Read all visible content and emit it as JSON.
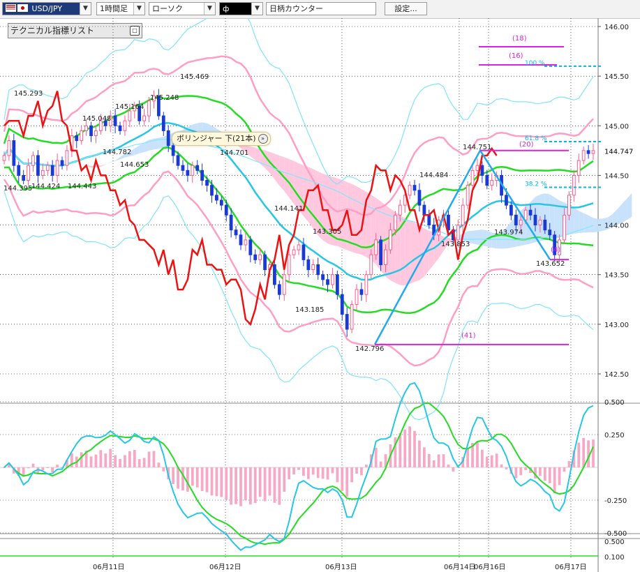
{
  "toolbar": {
    "pair": "USD/JPY",
    "timeframe": "1時間足",
    "chart_style": "ローソク",
    "symbol_box": "ф",
    "counter_label": "日柄カウンター",
    "settings_label": "設定..."
  },
  "indicator_panel": {
    "title": "テクニカル指標リスト"
  },
  "tooltip": {
    "text": "ボリンジャー 下(21本)"
  },
  "colors": {
    "up_candle": "#ff5a8a",
    "down_candle": "#1a3ad6",
    "bollinger_mid": "#26c6e6",
    "bollinger_inner": "#ff9ec4",
    "bollinger_outer": "#7fe3ff",
    "ma_green": "#22dd22",
    "red_line": "#ee1111",
    "cloud_pink": "#ffc8de",
    "cloud_blue": "#c8e2fb",
    "fib_cyan": "#00b4f0",
    "magenta": "#e020e0",
    "wave_line": "#20aaf0"
  },
  "chart_data": [
    {
      "type": "candlestick",
      "y_ticks": [
        "146.00",
        "145.50",
        "145.00",
        "144.50",
        "144.00",
        "143.50",
        "143.00",
        "142.50"
      ],
      "ylim": [
        142.4,
        146.05
      ],
      "x_ticks": [
        "06月11日",
        "06月12日",
        "06月13日",
        "06月14日",
        "06月16日",
        "06月17日"
      ],
      "last_price": "144.747",
      "price_labels": [
        {
          "text": "145.293",
          "value": 145.293
        },
        {
          "text": "144.395",
          "value": 144.395
        },
        {
          "text": "144.424",
          "value": 144.424
        },
        {
          "text": "144.443",
          "value": 144.443
        },
        {
          "text": "145.048",
          "value": 145.048
        },
        {
          "text": "144.782",
          "value": 144.782
        },
        {
          "text": "145.164",
          "value": 145.164
        },
        {
          "text": "144.653",
          "value": 144.653
        },
        {
          "text": "145.248",
          "value": 145.248
        },
        {
          "text": "145.469",
          "value": 145.469
        },
        {
          "text": "144.701",
          "value": 144.701
        },
        {
          "text": "144.141",
          "value": 144.141
        },
        {
          "text": "143.305",
          "value": 143.305
        },
        {
          "text": "143.185",
          "value": 143.185
        },
        {
          "text": "142.796",
          "value": 142.796
        },
        {
          "text": "144.484",
          "value": 144.484
        },
        {
          "text": "143.853",
          "value": 143.853
        },
        {
          "text": "144.751",
          "value": 144.751
        },
        {
          "text": "143.974",
          "value": 143.974
        },
        {
          "text": "143.652",
          "value": 143.652
        }
      ],
      "fib_labels": [
        {
          "text": "100 %",
          "value": 145.6
        },
        {
          "text": "61.8 %",
          "value": 144.84
        },
        {
          "text": "38.2 %",
          "value": 144.38
        }
      ],
      "count_labels": [
        "(18)",
        "(16)",
        "(20)",
        "(41)",
        "(4)"
      ],
      "closes": [
        144.7,
        144.85,
        144.6,
        144.5,
        144.45,
        144.6,
        144.7,
        144.5,
        144.55,
        144.6,
        144.5,
        144.65,
        144.6,
        144.75,
        144.9,
        144.85,
        144.95,
        145.0,
        144.9,
        144.95,
        145.05,
        145.0,
        145.1,
        145.0,
        144.95,
        145.05,
        145.15,
        145.2,
        145.05,
        145.1,
        145.25,
        145.3,
        145.1,
        144.95,
        144.8,
        144.7,
        144.6,
        144.55,
        144.5,
        144.6,
        144.55,
        144.45,
        144.4,
        144.3,
        144.25,
        144.2,
        144.1,
        143.95,
        143.9,
        143.8,
        143.85,
        143.7,
        143.65,
        143.7,
        143.55,
        143.6,
        143.4,
        143.3,
        143.5,
        143.7,
        143.75,
        143.8,
        143.65,
        143.55,
        143.6,
        143.5,
        143.45,
        143.4,
        143.5,
        143.3,
        143.1,
        142.95,
        143.2,
        143.35,
        143.3,
        143.5,
        143.7,
        143.85,
        143.6,
        143.75,
        143.95,
        144.1,
        144.2,
        144.3,
        144.4,
        144.35,
        144.2,
        144.1,
        144.0,
        143.9,
        144.05,
        144.1,
        143.95,
        143.85,
        144.0,
        144.2,
        144.4,
        144.55,
        144.6,
        144.5,
        144.4,
        144.45,
        144.5,
        144.3,
        144.2,
        144.1,
        144.0,
        144.05,
        144.15,
        144.1,
        144.0,
        144.05,
        143.95,
        143.9,
        143.7,
        143.85,
        144.1,
        144.3,
        144.5,
        144.65,
        144.75,
        144.72,
        144.75
      ]
    },
    {
      "type": "line",
      "y_ticks": [
        "0.500",
        "0.250",
        "-0.250",
        "-0.500"
      ],
      "ylim": [
        -0.62,
        0.62
      ]
    },
    {
      "type": "line",
      "y_ticks": [
        "0.500",
        "0.100"
      ],
      "ylim": [
        0.0,
        0.6
      ]
    }
  ]
}
